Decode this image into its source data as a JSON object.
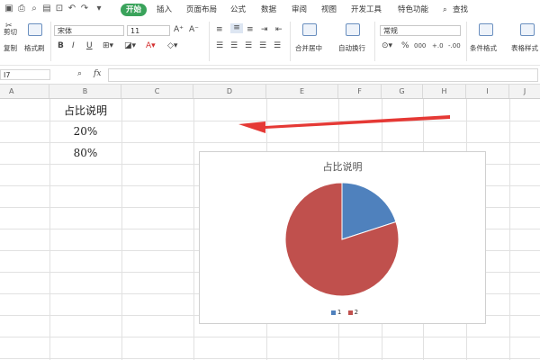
{
  "menu_tabs": [
    "开始",
    "插入",
    "页面布局",
    "公式",
    "数据",
    "审阅",
    "视图",
    "开发工具",
    "特色功能"
  ],
  "search_label": "查找",
  "ribbon": {
    "clipboard": {
      "cut": "剪切",
      "copy": "复制",
      "format_painter": "格式刷"
    },
    "font_name": "宋体",
    "font_size": "11",
    "merge_center": "合并居中",
    "wrap_text": "自动换行",
    "number_format": "常规",
    "conditional_format": "条件格式",
    "table_style": "表格样式"
  },
  "formula_bar": {
    "name_box": "I7",
    "fx_label": "fx",
    "formula": ""
  },
  "columns": [
    "A",
    "B",
    "C",
    "D",
    "E",
    "F",
    "G",
    "H",
    "I",
    "J"
  ],
  "cells": {
    "B1": "占比说明",
    "B2": "20%",
    "B3": "80%"
  },
  "chart_data": {
    "type": "pie",
    "title": "占比说明",
    "categories": [
      "1",
      "2"
    ],
    "values": [
      20,
      80
    ],
    "colors": [
      "#4f81bd",
      "#c0504d"
    ],
    "legend_placement": "bottom"
  },
  "annotation": {
    "arrow_color": "#e53935"
  }
}
